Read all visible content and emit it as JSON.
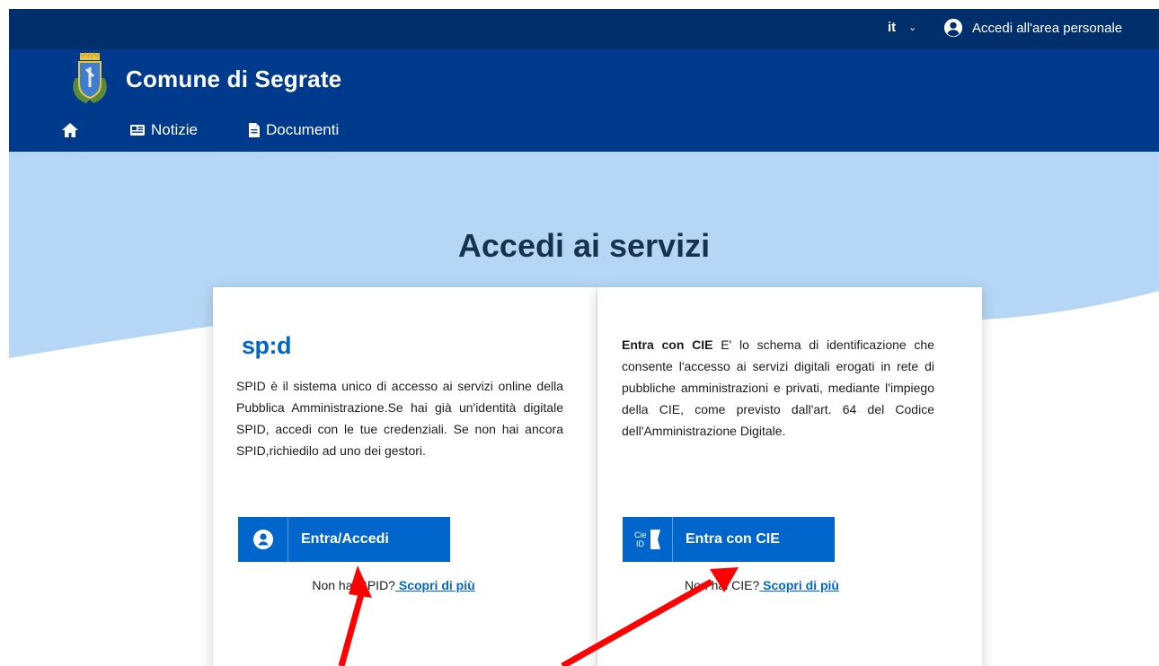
{
  "topbar": {
    "language": "it",
    "login_label": "Accedi all'area personale"
  },
  "header": {
    "brand_name": "Comune di Segrate",
    "nav": [
      {
        "label": "",
        "icon": "home-icon"
      },
      {
        "label": "Notizie",
        "icon": "newspaper-icon"
      },
      {
        "label": "Documenti",
        "icon": "document-icon"
      }
    ]
  },
  "main": {
    "title": "Accedi ai servizi",
    "spid": {
      "logo_text": "sp:d",
      "description": "SPID è il sistema unico di accesso ai servizi online della Pubblica Amministrazione.Se hai già un'identità digitale SPID, accedi con le tue credenziali. Se non hai ancora SPID,richiedilo ad uno dei gestori.",
      "button_label": "Entra/Accedi",
      "more_prefix": "Non hai SPID?",
      "more_link": " Scopri di più"
    },
    "cie": {
      "description_bold": "Entra con CIE",
      "description_rest": " E' lo schema di identificazione che consente l'accesso ai servizi digitali erogati in rete di pubbliche amministrazioni e privati, mediante l'impiego della CIE, come previsto dall'art. 64 del Codice dell'Amministrazione Digitale.",
      "button_icon_text": "Cie ID",
      "button_label": "Entra con CIE",
      "more_prefix": "Non hai CIE?",
      "more_link": " Scopri di più"
    }
  },
  "colors": {
    "topbar": "#002f6c",
    "header": "#003a8c",
    "primary": "#0066cc",
    "hero_light": "#b5d6f5",
    "annotation": "#ff0000"
  }
}
